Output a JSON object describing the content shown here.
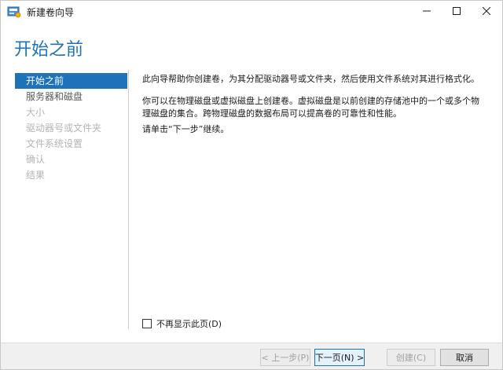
{
  "window": {
    "title": "新建卷向导",
    "icon": "volume-wizard-icon",
    "controls": [
      "minimize-icon",
      "maximize-icon",
      "close-icon"
    ]
  },
  "header": {
    "title": "开始之前"
  },
  "nav": {
    "items": [
      {
        "label": "开始之前",
        "state": "active"
      },
      {
        "label": "服务器和磁盘",
        "state": "normal"
      },
      {
        "label": "大小",
        "state": "disabled"
      },
      {
        "label": "驱动器号或文件夹",
        "state": "disabled"
      },
      {
        "label": "文件系统设置",
        "state": "disabled"
      },
      {
        "label": "确认",
        "state": "disabled"
      },
      {
        "label": "结果",
        "state": "disabled"
      }
    ]
  },
  "content": {
    "para1": "此向导帮助你创建卷，为其分配驱动器号或文件夹，然后使用文件系统对其进行格式化。",
    "para2": "你可以在物理磁盘或虚拟磁盘上创建卷。虚拟磁盘是以前创建的存储池中的一个或多个物理磁盘的集合。跨物理磁盘的数据布局可以提高卷的可靠性和性能。",
    "para3": "请单击“下一步”继续。"
  },
  "checkbox": {
    "label": "不再显示此页(D)",
    "checked": false
  },
  "footer": {
    "prev_label": "< 上一步(P)",
    "next_label": "下一页(N) >",
    "create_label": "创建(C)",
    "cancel_label": "取消"
  },
  "colors": {
    "accent": "#1e73b8",
    "disabled_text": "#b5b5b5"
  }
}
